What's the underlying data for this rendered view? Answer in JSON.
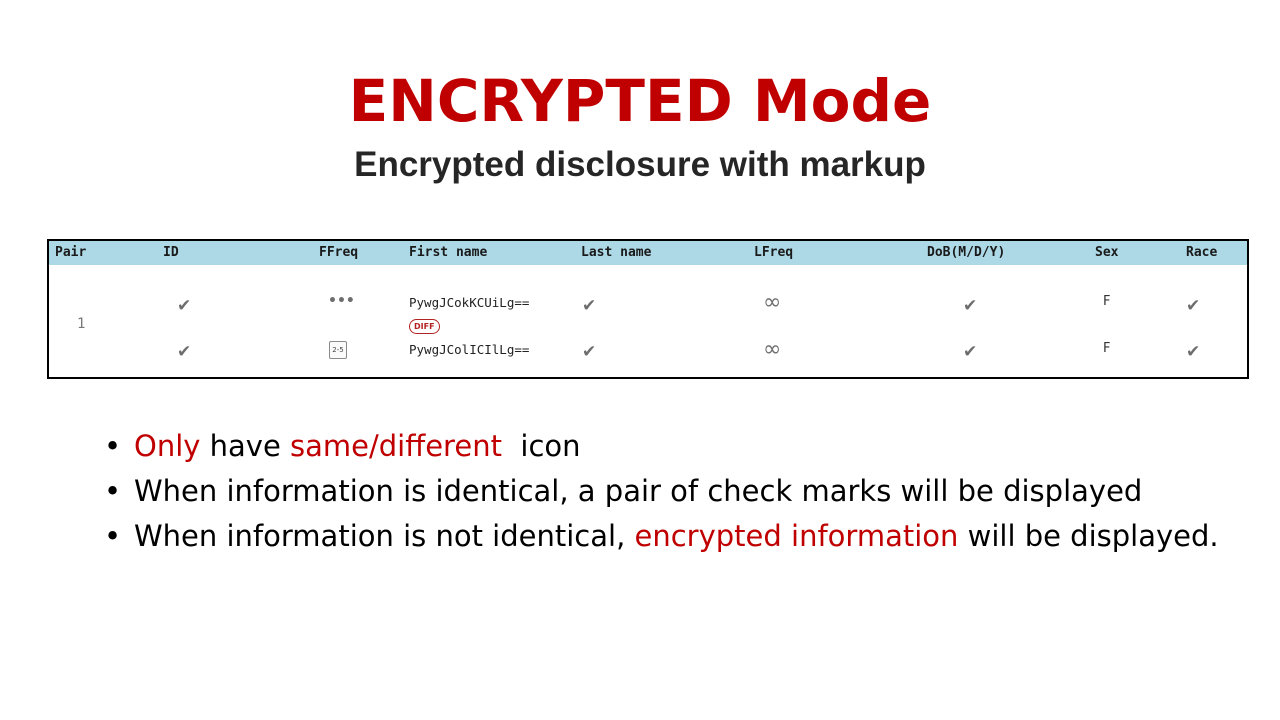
{
  "title": "ENCRYPTED Mode",
  "subtitle": "Encrypted disclosure with markup",
  "table": {
    "headers": {
      "pair": "Pair",
      "id": "ID",
      "ffreq": "FFreq",
      "first_name": "First name",
      "last_name": "Last name",
      "lfreq": "LFreq",
      "dob": "DoB(M/D/Y)",
      "sex": "Sex",
      "race": "Race"
    },
    "pair_number": "1",
    "rows": [
      {
        "id_icon": "check-icon",
        "ffreq_icon": "more-dots-icon",
        "first_name": "PywgJCokKCUiLg==",
        "first_name_badge": "DIFF",
        "last_name_icon": "check-icon",
        "lfreq_icon": "infinity-icon",
        "dob_icon": "check-icon",
        "sex": "F",
        "race_icon": "check-icon"
      },
      {
        "id_icon": "check-icon",
        "ffreq_icon": "range-icon",
        "ffreq_range_text": "2-5",
        "first_name": "PywgJColICIlLg==",
        "last_name_icon": "check-icon",
        "lfreq_icon": "infinity-icon",
        "dob_icon": "check-icon",
        "sex": "F",
        "race_icon": "check-icon"
      }
    ]
  },
  "bullets": [
    {
      "segments": [
        {
          "text": "Only",
          "highlight": true
        },
        {
          "text": " have ",
          "highlight": false
        },
        {
          "text": "same/different",
          "highlight": true
        },
        {
          "text": "  icon",
          "highlight": false
        }
      ]
    },
    {
      "segments": [
        {
          "text": "When information is identical, a pair of check marks will be displayed",
          "highlight": false
        }
      ]
    },
    {
      "segments": [
        {
          "text": "When information is not identical, ",
          "highlight": false
        },
        {
          "text": "encrypted information",
          "highlight": true
        },
        {
          "text": " will be displayed.",
          "highlight": false
        }
      ]
    }
  ],
  "colors": {
    "accent_red": "#c00000",
    "header_bg": "#add8e6",
    "icon_gray": "#6e6e6e"
  }
}
